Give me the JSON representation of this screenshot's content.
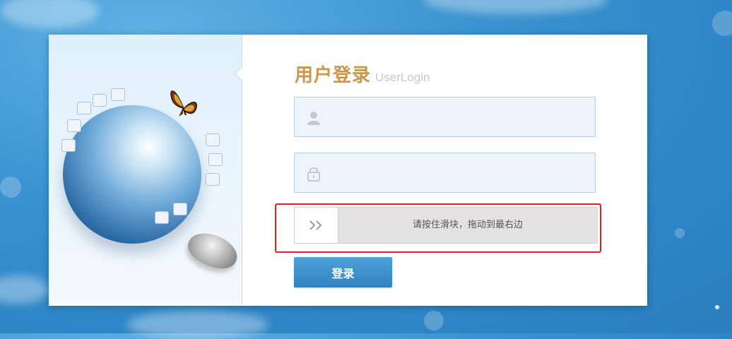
{
  "login": {
    "title_cn": "用户登录",
    "title_en": "UserLogin",
    "username": {
      "value": "",
      "placeholder": "",
      "icon": "user-icon"
    },
    "password": {
      "value": "",
      "placeholder": "",
      "icon": "lock-icon"
    },
    "slider": {
      "text": "请按住滑块，拖动到最右边",
      "handle_glyph": ">>",
      "progress": 0
    },
    "submit_label": "登录"
  },
  "colors": {
    "title": "#c9964e",
    "button": "#3a90cc",
    "highlight_frame": "#e31f1f",
    "field_bg": "#edf4fb"
  }
}
